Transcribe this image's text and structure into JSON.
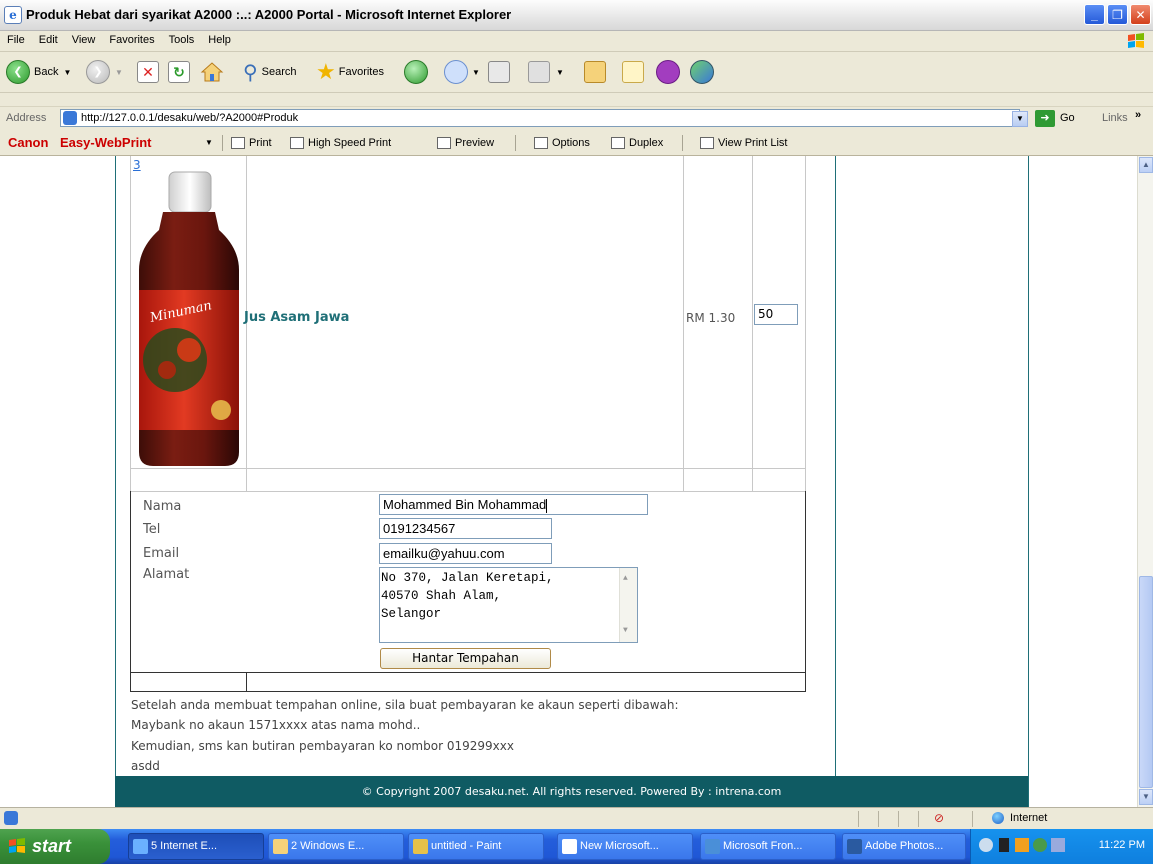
{
  "window": {
    "title": "Produk Hebat dari syarikat A2000 :..: A2000 Portal - Microsoft Internet Explorer"
  },
  "menu": [
    "File",
    "Edit",
    "View",
    "Favorites",
    "Tools",
    "Help"
  ],
  "toolbar": {
    "back_label": "Back",
    "search_label": "Search",
    "favorites_label": "Favorites"
  },
  "address": {
    "label": "Address",
    "url": "http://127.0.0.1/desaku/web/?A2000#Produk",
    "go_label": "Go",
    "links_label": "Links"
  },
  "canon_bar": {
    "brand": "Canon",
    "product": "Easy-WebPrint",
    "items": [
      "Print",
      "High Speed Print",
      "Preview",
      "Options",
      "Duplex",
      "View Print List"
    ]
  },
  "product": {
    "number_link": "3",
    "name": "Jus Asam Jawa",
    "price": "RM 1.30",
    "quantity": "50",
    "image_label": "Minuman"
  },
  "form": {
    "name_label": "Nama",
    "name_value": "Mohammed Bin Mohammad",
    "tel_label": "Tel",
    "tel_value": "0191234567",
    "email_label": "Email",
    "email_value": "emailku@yahuu.com",
    "address_label": "Alamat",
    "address_value": "No 370, Jalan Keretapi,\n40570 Shah Alam,\nSelangor",
    "submit_label": "Hantar Tempahan"
  },
  "notes": [
    "Setelah anda membuat tempahan online, sila buat pembayaran ke akaun seperti dibawah:",
    "Maybank no akaun 1571xxxx atas nama mohd..",
    "Kemudian, sms kan butiran pembayaran ko nombor 019299xxx",
    "asdd"
  ],
  "footer": "© Copyright 2007 desaku.net. All rights reserved.  Powered By  : intrena.com",
  "statusbar": {
    "zone": "Internet"
  },
  "taskbar": {
    "start_label": "start",
    "tasks": [
      {
        "label": "5 Internet E...",
        "active": true
      },
      {
        "label": "2 Windows E...",
        "active": false
      },
      {
        "label": "untitled - Paint",
        "active": false
      },
      {
        "label": "New Microsoft...",
        "active": false
      },
      {
        "label": "Microsoft Fron...",
        "active": false
      },
      {
        "label": "Adobe Photos...",
        "active": false
      }
    ],
    "clock": "11:22 PM"
  },
  "colors": {
    "accent": "#1f6f77",
    "footer_bg": "#0f5b63",
    "taskbar": "#245edb",
    "start": "#3a913a"
  }
}
